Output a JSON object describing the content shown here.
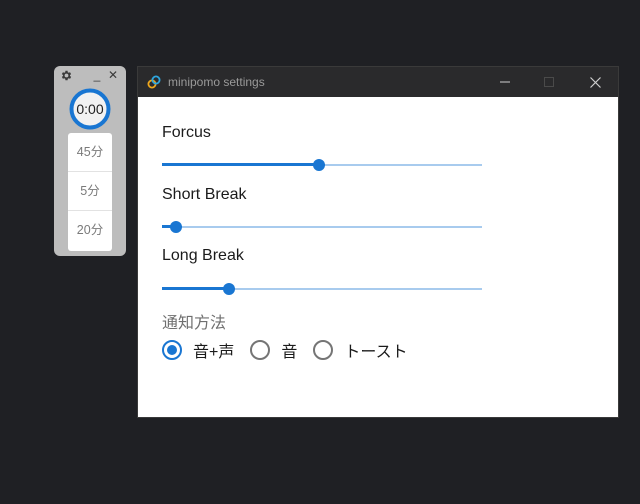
{
  "mini_timer": {
    "time": "0:00",
    "minimize_glyph": "_",
    "close_glyph": "✕",
    "presets": [
      "45分",
      "5分",
      "20分"
    ]
  },
  "settings_window": {
    "title": "minipomo settings",
    "sliders": [
      {
        "key": "focus",
        "label": "Forcus",
        "value_fraction": 0.49
      },
      {
        "key": "short_break",
        "label": "Short Break",
        "value_fraction": 0.045
      },
      {
        "key": "long_break",
        "label": "Long Break",
        "value_fraction": 0.21
      }
    ],
    "notification": {
      "label": "通知方法",
      "options": [
        "音+声",
        "音",
        "トースト"
      ],
      "selected": "音+声"
    }
  },
  "colors": {
    "accent": "#1976d2",
    "track": "#a8cbee",
    "desktop": "#1f2024",
    "titlebar": "#2a2a2c"
  },
  "icons": [
    "gear-icon",
    "minimize-icon",
    "close-icon",
    "app-icon",
    "maximize-icon"
  ]
}
